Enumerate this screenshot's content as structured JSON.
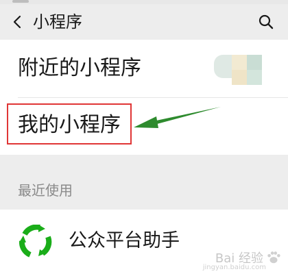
{
  "nav": {
    "title": "小程序"
  },
  "menu": {
    "nearby_label": "附近的小程序",
    "mine_label": "我的小程序"
  },
  "recent": {
    "section_label": "最近使用",
    "items": [
      {
        "label": "公众平台助手"
      }
    ]
  },
  "icons": {
    "back": "chevron-left-icon",
    "search": "search-icon",
    "app": "wechat-platform-assistant-icon"
  },
  "colors": {
    "accent_green": "#1aad19",
    "highlight_red": "#e03535",
    "arrow_green": "#2e8b2e",
    "background": "#ededed"
  },
  "watermark": {
    "text": "Bai 经验",
    "url": "jingyan.baidu.com"
  }
}
